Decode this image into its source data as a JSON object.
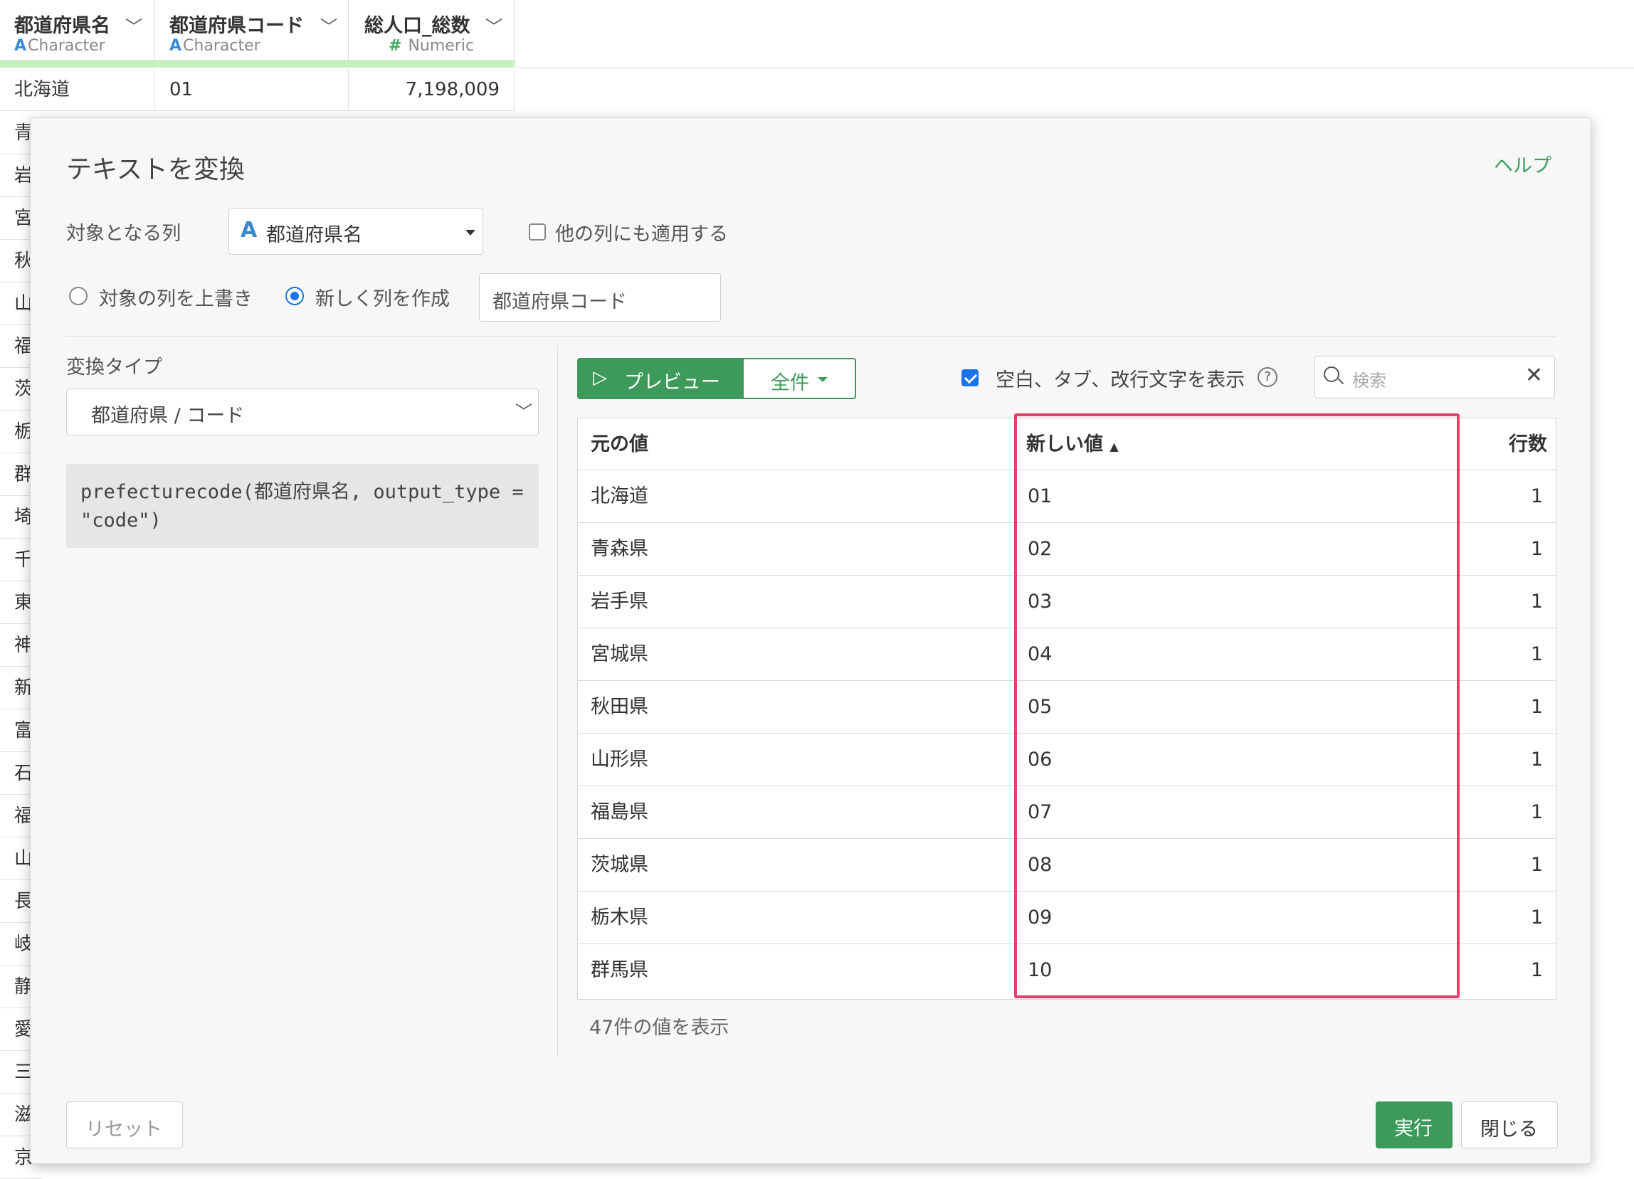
{
  "grid": {
    "columns": [
      {
        "name": "都道府県名",
        "type_icon": "A",
        "type": "Character"
      },
      {
        "name": "都道府県コード",
        "type_icon": "A",
        "type": "Character"
      },
      {
        "name": "総人口_総数",
        "type_icon": "#",
        "type": "Numeric"
      }
    ],
    "first_row": {
      "c1": "北海道",
      "c2": "01",
      "c3": "7,198,009"
    },
    "left_chars": [
      "青",
      "岩",
      "宮",
      "秋",
      "山",
      "福",
      "茨",
      "栃",
      "群",
      "埼",
      "千",
      "東",
      "神",
      "新",
      "富",
      "石",
      "福",
      "山",
      "長",
      "岐",
      "静",
      "愛",
      "三",
      "滋",
      "京"
    ]
  },
  "modal": {
    "title": "テキストを変換",
    "help": "ヘルプ",
    "target_label": "対象となる列",
    "target_icon": "A",
    "target_value": "都道府県名",
    "apply_other_label": "他の列にも適用する",
    "overwrite_label": "対象の列を上書き",
    "new_column_label": "新しく列を作成",
    "new_column_value": "都道府県コード",
    "convert_type_label": "変換タイプ",
    "convert_type_value": "都道府県 / コード",
    "code": "prefecturecode(都道府県名, output_type = \"code\")",
    "preview_label": "プレビュー",
    "all_label": "全件",
    "show_whitespace_label": "空白、タブ、改行文字を表示",
    "help_q": "?",
    "search_placeholder": "検索",
    "table": {
      "headers": {
        "original": "元の値",
        "new": "新しい値",
        "count": "行数"
      },
      "rows": [
        {
          "original": "北海道",
          "new": "01",
          "count": "1"
        },
        {
          "original": "青森県",
          "new": "02",
          "count": "1"
        },
        {
          "original": "岩手県",
          "new": "03",
          "count": "1"
        },
        {
          "original": "宮城県",
          "new": "04",
          "count": "1"
        },
        {
          "original": "秋田県",
          "new": "05",
          "count": "1"
        },
        {
          "original": "山形県",
          "new": "06",
          "count": "1"
        },
        {
          "original": "福島県",
          "new": "07",
          "count": "1"
        },
        {
          "original": "茨城県",
          "new": "08",
          "count": "1"
        },
        {
          "original": "栃木県",
          "new": "09",
          "count": "1"
        },
        {
          "original": "群馬県",
          "new": "10",
          "count": "1"
        }
      ]
    },
    "showing_text": "47件の値を表示",
    "reset_label": "リセット",
    "run_label": "実行",
    "close_label": "閉じる"
  },
  "colors": {
    "accent_green": "#3d9a5a",
    "highlight": "#e33f6d",
    "checkbox_blue": "#1a73e8"
  }
}
